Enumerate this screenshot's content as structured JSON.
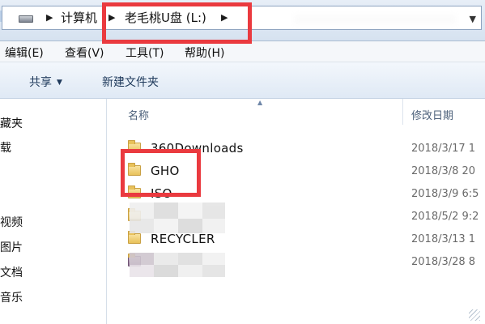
{
  "address_bar": {
    "crumb1": "计算机",
    "crumb2": "老毛桃U盘 (L:)"
  },
  "menu": {
    "edit": "编辑(E)",
    "view": "查看(V)",
    "tools": "工具(T)",
    "help": "帮助(H)"
  },
  "toolbar": {
    "share": "共享",
    "new_folder": "新建文件夹"
  },
  "nav_pane": {
    "items": [
      "藏夹",
      "载",
      "视频",
      "图片",
      "文档",
      "音乐"
    ]
  },
  "columns": {
    "name": "名称",
    "modified": "修改日期"
  },
  "files": [
    {
      "name": "360Downloads",
      "date": "2018/3/17 1"
    },
    {
      "name": "GHO",
      "date": "2018/3/8 20"
    },
    {
      "name": "ISO",
      "date": "2018/3/9 6:5"
    },
    {
      "name": "",
      "date": "2018/5/2 9:2"
    },
    {
      "name": "RECYCLER",
      "date": "2018/3/13 1"
    },
    {
      "name": "",
      "date": "2018/3/28 8"
    }
  ],
  "colors": {
    "highlight": "#ea3a3f"
  },
  "icons": [
    "drive-icon",
    "folder-icon",
    "chevron-right-icon",
    "chevron-down-icon"
  ]
}
